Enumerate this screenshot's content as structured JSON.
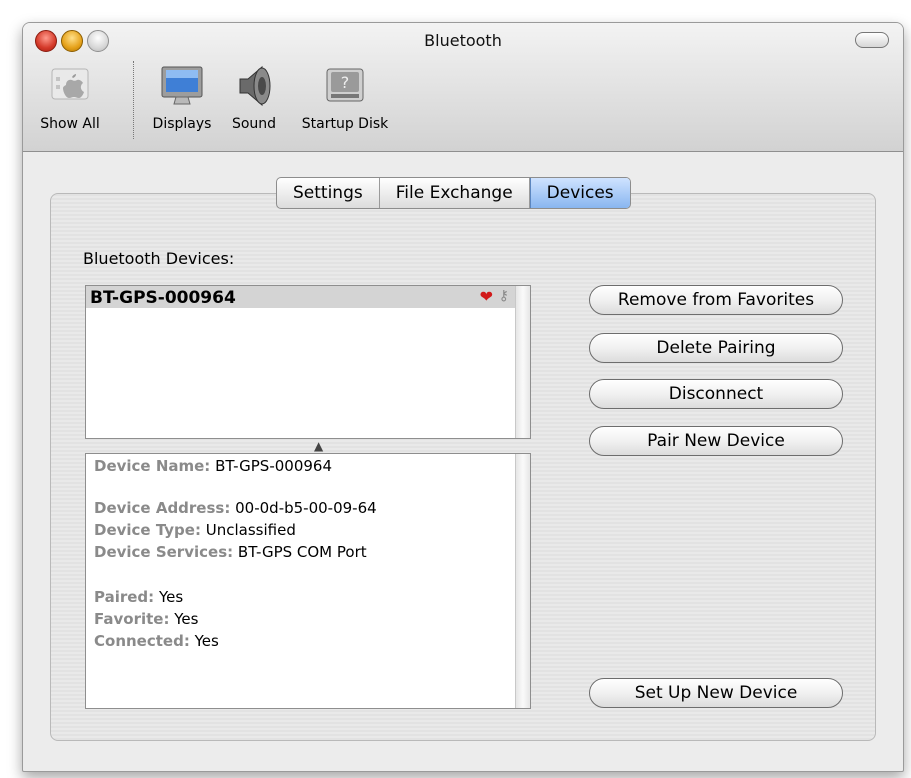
{
  "window": {
    "title": "Bluetooth"
  },
  "toolbar": {
    "items": [
      {
        "label": "Show All",
        "icon": "apple-logo-icon"
      },
      {
        "label": "Displays",
        "icon": "display-icon"
      },
      {
        "label": "Sound",
        "icon": "speaker-icon"
      },
      {
        "label": "Startup Disk",
        "icon": "hard-disk-icon"
      }
    ]
  },
  "tabs": [
    {
      "label": "Settings",
      "active": false
    },
    {
      "label": "File Exchange",
      "active": false
    },
    {
      "label": "Devices",
      "active": true
    }
  ],
  "devices_label": "Bluetooth Devices:",
  "devices": [
    {
      "name": "BT-GPS-000964",
      "favorite": true,
      "paired": true
    }
  ],
  "details": {
    "device_name": {
      "key": "Device Name:",
      "value": "BT-GPS-000964"
    },
    "device_address": {
      "key": "Device Address:",
      "value": "00-0d-b5-00-09-64"
    },
    "device_type": {
      "key": "Device Type:",
      "value": "Unclassified"
    },
    "device_services": {
      "key": "Device Services:",
      "value": "BT-GPS COM Port"
    },
    "paired": {
      "key": "Paired:",
      "value": "Yes"
    },
    "favorite": {
      "key": "Favorite:",
      "value": "Yes"
    },
    "connected": {
      "key": "Connected:",
      "value": "Yes"
    }
  },
  "buttons": {
    "remove_favorites": "Remove from Favorites",
    "delete_pairing": "Delete Pairing",
    "disconnect": "Disconnect",
    "pair_new": "Pair New Device",
    "set_up_new": "Set Up New Device"
  },
  "colors": {
    "active_tab": "#89b6f0",
    "selected_row": "#d4d4d4",
    "favorite_heart": "#d11a1a",
    "detail_key": "#8a8a8a"
  }
}
